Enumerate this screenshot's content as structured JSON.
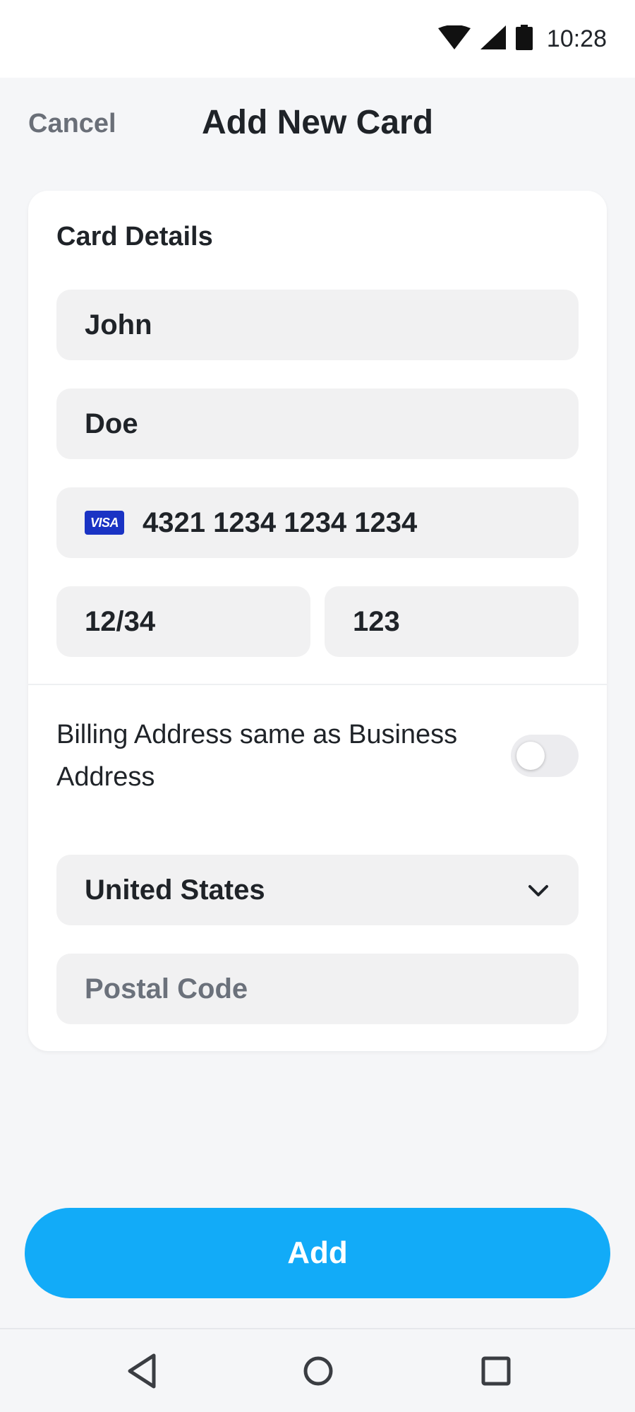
{
  "status_bar": {
    "time": "10:28",
    "icons": [
      "wifi-icon",
      "signal-icon",
      "battery-icon"
    ]
  },
  "header": {
    "cancel_label": "Cancel",
    "title": "Add New Card"
  },
  "card": {
    "section_title": "Card Details",
    "first_name": "John",
    "last_name": "Doe",
    "card_brand": "VISA",
    "card_number": "4321 1234 1234 1234",
    "expiry": "12/34",
    "cvc": "123",
    "billing_same_label": "Billing Address same as Business Address",
    "billing_same_enabled": false,
    "country": "United States",
    "postal_code_placeholder": "Postal Code"
  },
  "add_button_label": "Add",
  "nav": {
    "icons": [
      "back-icon",
      "home-icon",
      "recents-icon"
    ]
  },
  "colors": {
    "accent": "#12abf8",
    "visa_blue": "#1a33c4",
    "field_bg": "#f1f1f2",
    "page_bg": "#f5f6f8"
  }
}
